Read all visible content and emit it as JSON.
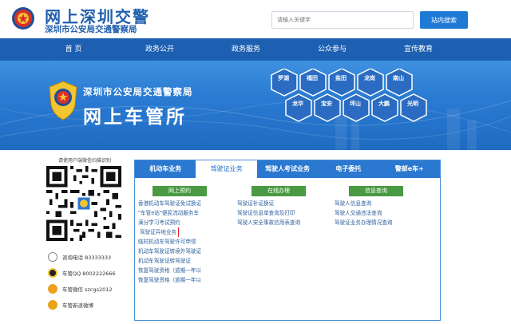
{
  "header": {
    "title": "网上深圳交警",
    "subtitle": "深圳市公安局交通警察局",
    "search_placeholder": "请输入关键字",
    "search_button": "站内搜索",
    "colors": {
      "brand": "#1f5fae",
      "nav": "#1d5fb1",
      "accent": "#1f7ad6"
    }
  },
  "nav": {
    "items": [
      "首  页",
      "政务公开",
      "政务服务",
      "公众参与",
      "宣传教育"
    ]
  },
  "banner": {
    "org": "深圳市公安局交通警察局",
    "title": "网上车管所",
    "districts": [
      "罗湖",
      "福田",
      "盐田",
      "龙岗",
      "南山",
      "龙华",
      "宝安",
      "坪山",
      "大鹏",
      "光明"
    ]
  },
  "left_panel": {
    "qr_caption": "请使用户端微信扫描识别",
    "contacts": [
      {
        "icon": "phone-icon",
        "label": "咨询电话 83333333"
      },
      {
        "icon": "qq-icon",
        "label": "车管QQ 8002222666"
      },
      {
        "icon": "wechat-icon",
        "label": "车管微信 szcgs2012"
      },
      {
        "icon": "weibo-icon",
        "label": "车管新浪微博"
      }
    ]
  },
  "tabs": {
    "items": [
      "机动车业务",
      "驾驶证业务",
      "驾驶人考试业务",
      "电子委托",
      "警邮e车+"
    ],
    "active_index": 1
  },
  "columns": {
    "col1": {
      "head": "网上预约",
      "items": [
        "香港机动车驾驶证免试换证",
        "\"车管e站\"便民流动服务车",
        "满分学习考试预约",
        "驾驶证异地业务",
        "临时机动车驾驶许可申领",
        "机动车驾驶证转境外驾驶证",
        "机动车驾驶证转驾驶证",
        "恢复驾驶资格（逾期一年以",
        "恢复驾驶资格（逾期一年以"
      ],
      "highlighted_index": 3
    },
    "col2": {
      "head": "在线办理",
      "items": [
        "驾驶证补证换证",
        "驾驶证信息单查询及打印",
        "驾驶人安全事故信用表查询"
      ]
    },
    "col3": {
      "head": "信息查询",
      "items": [
        "驾驶人信息查询",
        "驾驶人交通违法查询",
        "驾驶证业务办理情况查询"
      ]
    }
  }
}
